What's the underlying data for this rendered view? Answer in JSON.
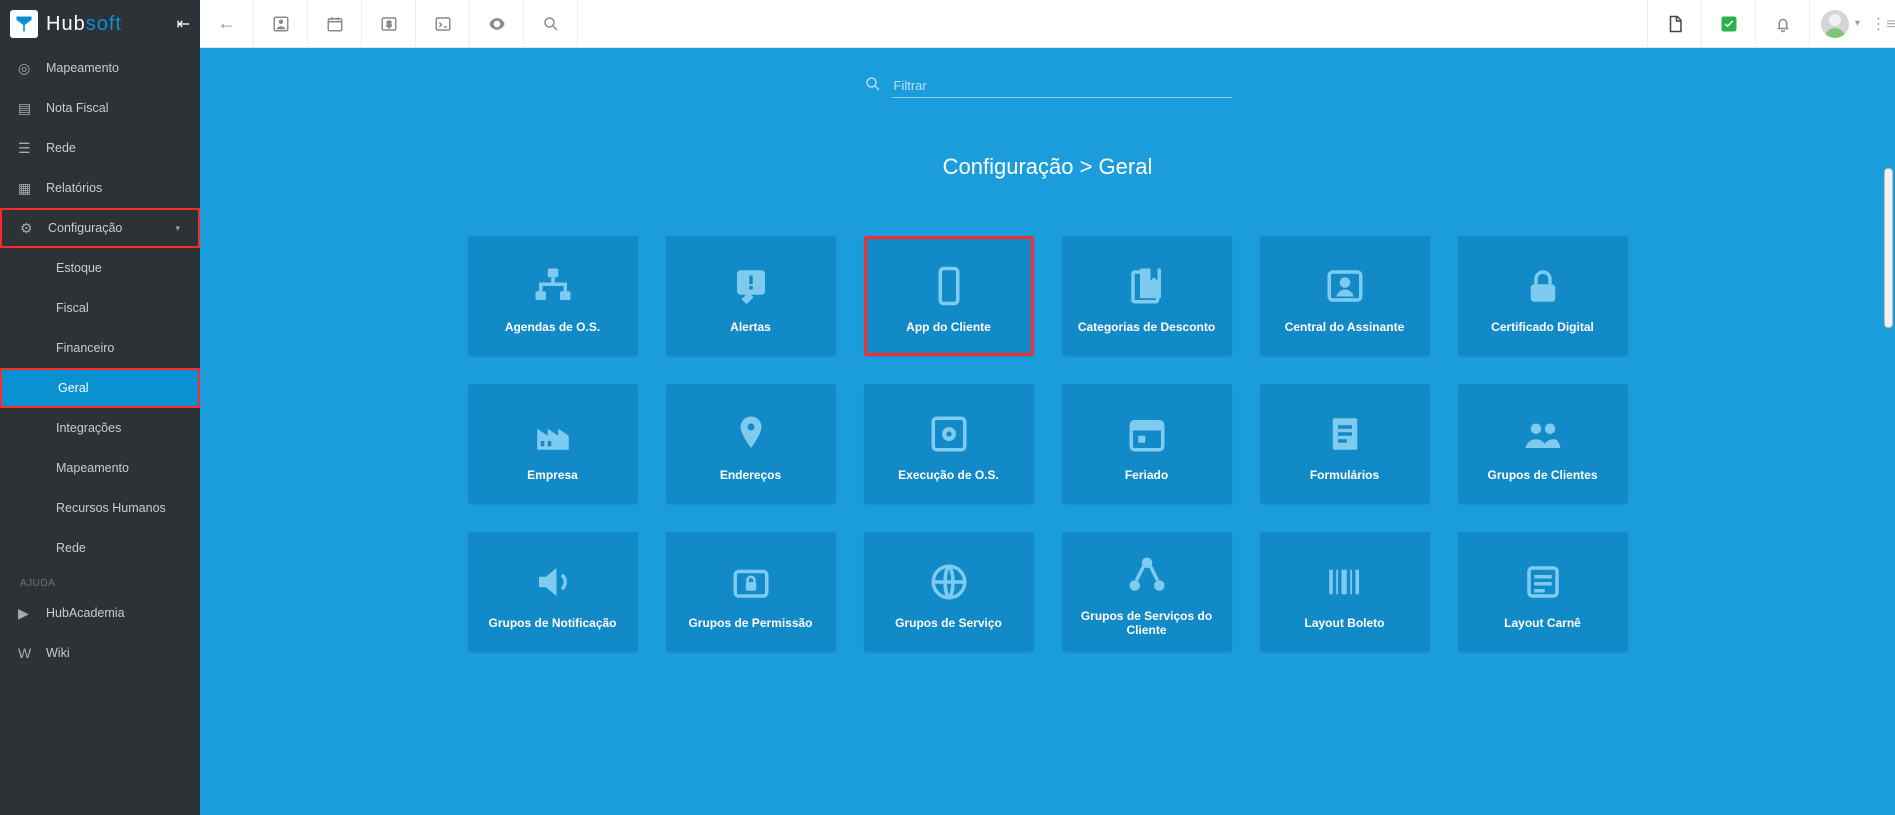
{
  "brand": {
    "hub": "Hub",
    "soft": "soft"
  },
  "filter": {
    "placeholder": "Filtrar"
  },
  "breadcrumb": "Configuração > Geral",
  "sidebar": {
    "main": [
      {
        "label": "Mapeamento",
        "icon": "pin"
      },
      {
        "label": "Nota Fiscal",
        "icon": "receipt"
      },
      {
        "label": "Rede",
        "icon": "network"
      },
      {
        "label": "Relatórios",
        "icon": "doc"
      },
      {
        "label": "Configuração",
        "icon": "gear",
        "expandable": true,
        "highlight": true
      }
    ],
    "config_sub": [
      {
        "label": "Estoque"
      },
      {
        "label": "Fiscal"
      },
      {
        "label": "Financeiro"
      },
      {
        "label": "Geral",
        "active": true
      },
      {
        "label": "Integrações"
      },
      {
        "label": "Mapeamento"
      },
      {
        "label": "Recursos Humanos"
      },
      {
        "label": "Rede"
      }
    ],
    "help_heading": "AJUDA",
    "help": [
      {
        "label": "HubAcademia",
        "icon": "play"
      },
      {
        "label": "Wiki",
        "icon": "wiki"
      }
    ]
  },
  "cards": [
    {
      "label": "Agendas de O.S.",
      "icon": "org"
    },
    {
      "label": "Alertas",
      "icon": "alert"
    },
    {
      "label": "App do Cliente",
      "icon": "phone",
      "highlight": true
    },
    {
      "label": "Categorias de Desconto",
      "icon": "bookmarks"
    },
    {
      "label": "Central do Assinante",
      "icon": "idcard"
    },
    {
      "label": "Certificado Digital",
      "icon": "lock"
    },
    {
      "label": "Empresa",
      "icon": "factory"
    },
    {
      "label": "Endereços",
      "icon": "pin"
    },
    {
      "label": "Execução de O.S.",
      "icon": "gearbox"
    },
    {
      "label": "Feriado",
      "icon": "calendar"
    },
    {
      "label": "Formulários",
      "icon": "forms"
    },
    {
      "label": "Grupos de Clientes",
      "icon": "people"
    },
    {
      "label": "Grupos de Notificação",
      "icon": "speaker"
    },
    {
      "label": "Grupos de Permissão",
      "icon": "folderlock"
    },
    {
      "label": "Grupos de Serviço",
      "icon": "globe"
    },
    {
      "label": "Grupos de Serviços do Cliente",
      "icon": "nodes"
    },
    {
      "label": "Layout Boleto",
      "icon": "barcode"
    },
    {
      "label": "Layout Carnê",
      "icon": "lines"
    }
  ]
}
